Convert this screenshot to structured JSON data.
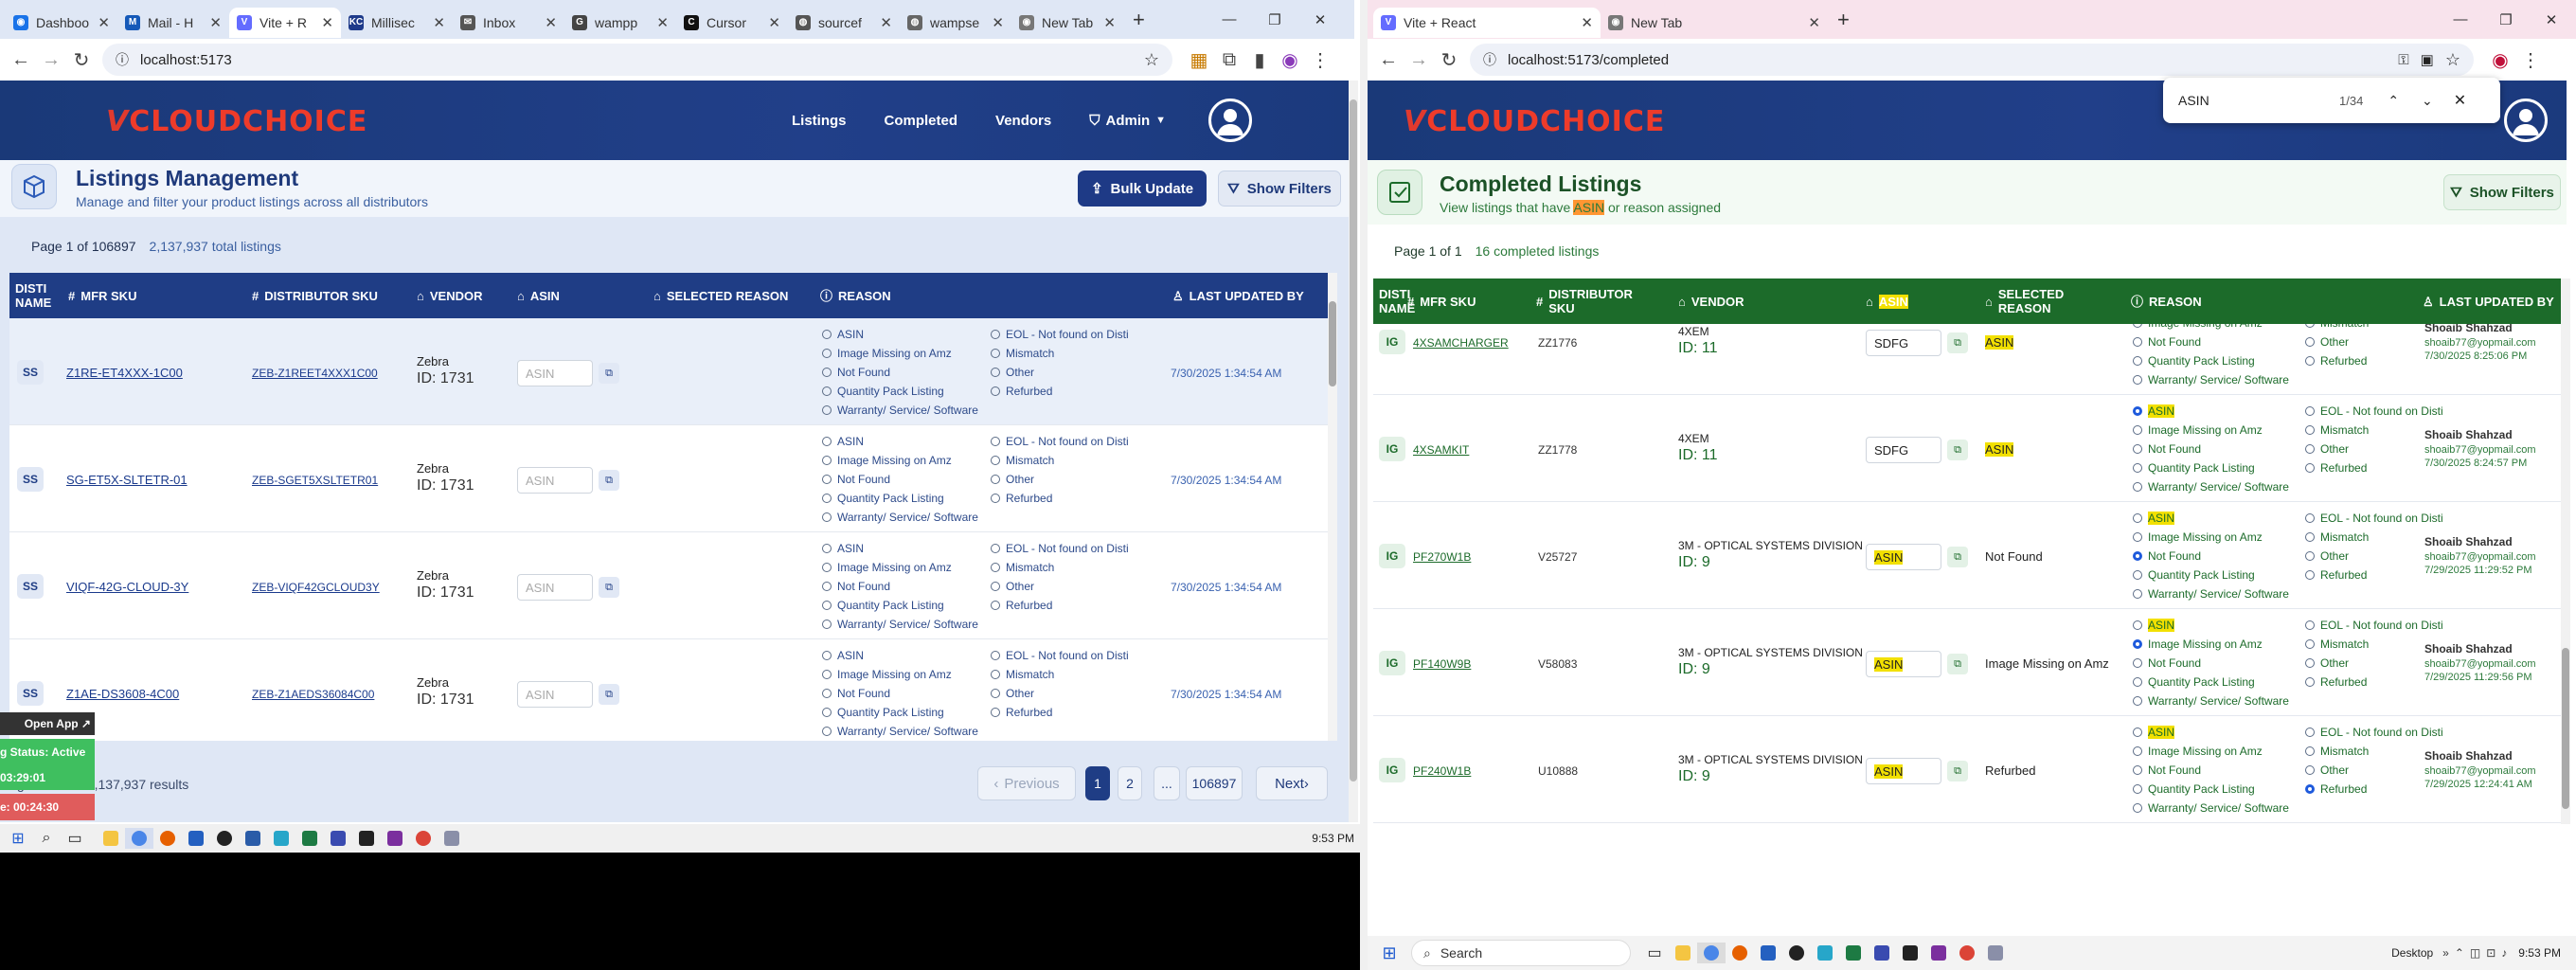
{
  "left_window": {
    "tabs": [
      {
        "title": "Dashboo",
        "color": "#1a73e8",
        "glyph": "◉"
      },
      {
        "title": "Mail - H",
        "color": "#1559b8",
        "glyph": "M"
      },
      {
        "title": "Vite + R",
        "color": "#646cff",
        "glyph": "V",
        "active": true
      },
      {
        "title": "Millisec",
        "color": "#1e3a8a",
        "glyph": "KC"
      },
      {
        "title": "Inbox",
        "color": "#555",
        "glyph": "✉"
      },
      {
        "title": "wampp",
        "color": "#444",
        "glyph": "G"
      },
      {
        "title": "Cursor",
        "color": "#111",
        "glyph": "C"
      },
      {
        "title": "sourcef",
        "color": "#555",
        "glyph": "◍"
      },
      {
        "title": "wampse",
        "color": "#666",
        "glyph": "◍"
      },
      {
        "title": "New Tab",
        "color": "#777",
        "glyph": "◉"
      }
    ],
    "url": "localhost:5173",
    "header": {
      "logo_v": "V",
      "logo_text": "CLOUDCHOICE",
      "nav": [
        "Listings",
        "Completed",
        "Vendors"
      ],
      "admin": "Admin"
    },
    "page": {
      "title": "Listings Management",
      "subtitle": "Manage and filter your product listings across all distributors",
      "bulk_update": "Bulk Update",
      "show_filters": "Show Filters",
      "page_info": "Page 1 of 106897",
      "total": "2,137,937 total listings"
    },
    "columns": [
      "DISTI NAME",
      "MFR SKU",
      "DISTRIBUTOR SKU",
      "VENDOR",
      "ASIN",
      "SELECTED REASON",
      "REASON",
      "LAST UPDATED BY"
    ],
    "reasons_left": [
      "ASIN",
      "Image Missing on Amz",
      "Not Found",
      "Quantity Pack Listing",
      "Warranty/ Service/ Software"
    ],
    "reasons_right": [
      "EOL - Not found on Disti",
      "Mismatch",
      "Other",
      "Refurbed"
    ],
    "asin_placeholder": "ASIN",
    "rows": [
      {
        "disti": "SS",
        "mfr": "Z1RE-ET4XXX-1C00",
        "dsku": "ZEB-Z1REET4XXX1C00",
        "vendor": "Zebra",
        "vid": "ID: 1731",
        "updated": "7/30/2025 1:34:54 AM"
      },
      {
        "disti": "SS",
        "mfr": "SG-ET5X-SLTETR-01",
        "dsku": "ZEB-SGET5XSLTETR01",
        "vendor": "Zebra",
        "vid": "ID: 1731",
        "updated": "7/30/2025 1:34:54 AM"
      },
      {
        "disti": "SS",
        "mfr": "VIQF-42G-CLOUD-3Y",
        "dsku": "ZEB-VIQF42GCLOUD3Y",
        "vendor": "Zebra",
        "vid": "ID: 1731",
        "updated": "7/30/2025 1:34:54 AM"
      },
      {
        "disti": "SS",
        "mfr": "Z1AE-DS3608-4C00",
        "dsku": "ZEB-Z1AEDS36084C00",
        "vendor": "Zebra",
        "vid": "ID: 1731",
        "updated": "7/30/2025 1:34:54 AM"
      }
    ],
    "footer": {
      "showing": "ving 1 to 20 of 2,137,937 results",
      "prev": "Previous",
      "pages": [
        "1",
        "2",
        "...",
        "106897"
      ],
      "next": "Next"
    },
    "overlay": {
      "open_app": "Open App ↗",
      "status": "g Status: Active",
      "time1": "03:29:01",
      "time2": "e: 00:24:30"
    },
    "clock": "9:53 PM"
  },
  "right_window": {
    "tabs": [
      {
        "title": "Vite + React",
        "color": "#646cff",
        "glyph": "V",
        "active": true
      },
      {
        "title": "New Tab",
        "color": "#777",
        "glyph": "◉"
      }
    ],
    "url": "localhost:5173/completed",
    "find": {
      "query": "ASIN",
      "count": "1/34"
    },
    "header": {
      "logo_v": "V",
      "logo_text": "CLOUDCHOICE"
    },
    "page": {
      "title": "Completed Listings",
      "sub_pre": "View listings that have ",
      "sub_hl": "ASIN",
      "sub_post": " or reason assigned",
      "show_filters": "Show Filters",
      "page_info": "Page 1 of 1",
      "total": "16 completed listings"
    },
    "columns": [
      "DISTI NAME",
      "MFR SKU",
      "DISTRIBUTOR SKU",
      "VENDOR",
      "ASIN",
      "SELECTED REASON",
      "REASON",
      "LAST UPDATED BY"
    ],
    "reasons_left": [
      "ASIN",
      "Image Missing on Amz",
      "Not Found",
      "Quantity Pack Listing",
      "Warranty/ Service/ Software"
    ],
    "reasons_right": [
      "EOL - Not found on Disti",
      "Mismatch",
      "Other",
      "Refurbed"
    ],
    "rows": [
      {
        "disti": "IG",
        "mfr": "4XSAMCHARGER",
        "dsku": "ZZ1776",
        "vendor": "4XEM",
        "vid": "ID: 11",
        "asin": "SDFG",
        "selected": "ASIN",
        "sel_hl": true,
        "checked": "",
        "user": "Shoaib Shahzad",
        "email": "shoaib77@yopmail.com",
        "updated": "7/30/2025 8:25:06 PM",
        "partial": true
      },
      {
        "disti": "IG",
        "mfr": "4XSAMKIT",
        "dsku": "ZZ1778",
        "vendor": "4XEM",
        "vid": "ID: 11",
        "asin": "SDFG",
        "selected": "ASIN",
        "sel_hl": true,
        "checked": "ASIN",
        "user": "Shoaib Shahzad",
        "email": "shoaib77@yopmail.com",
        "updated": "7/30/2025 8:24:57 PM"
      },
      {
        "disti": "IG",
        "mfr": "PF270W1B",
        "dsku": "V25727",
        "vendor": "3M - OPTICAL SYSTEMS DIVISION",
        "vid": "ID: 9",
        "asin": "ASIN",
        "asin_hl": true,
        "selected": "Not Found",
        "checked": "Not Found",
        "user": "Shoaib Shahzad",
        "email": "shoaib77@yopmail.com",
        "updated": "7/29/2025 11:29:52 PM"
      },
      {
        "disti": "IG",
        "mfr": "PF140W9B",
        "dsku": "V58083",
        "vendor": "3M - OPTICAL SYSTEMS DIVISION",
        "vid": "ID: 9",
        "asin": "ASIN",
        "asin_hl": true,
        "selected": "Image Missing on Amz",
        "checked": "Image Missing on Amz",
        "user": "Shoaib Shahzad",
        "email": "shoaib77@yopmail.com",
        "updated": "7/29/2025 11:29:56 PM"
      },
      {
        "disti": "IG",
        "mfr": "PF240W1B",
        "dsku": "U10888",
        "vendor": "3M - OPTICAL SYSTEMS DIVISION",
        "vid": "ID: 9",
        "asin": "ASIN",
        "asin_hl": true,
        "selected": "Refurbed",
        "checked": "Refurbed",
        "user": "Shoaib Shahzad",
        "email": "shoaib77@yopmail.com",
        "updated": "7/29/2025 12:24:41 AM"
      }
    ],
    "taskbar": {
      "search": "Search",
      "desktop": "Desktop",
      "clock": "9:53 PM"
    }
  },
  "colors": {
    "nav_blue": "#1f3d85",
    "title_blue": "#1f3a7b",
    "completed_green": "#1c6b2a",
    "link_blue": "#1a3a8c",
    "pink_bar": "#f8e3ec",
    "left_bar": "#dfe7f5",
    "cyan": "#14a1ad"
  }
}
